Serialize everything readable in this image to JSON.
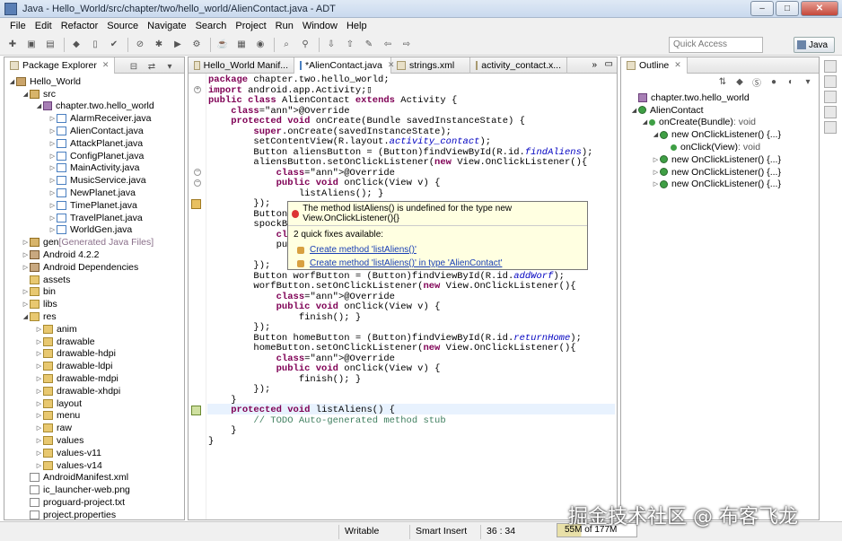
{
  "window": {
    "title": "Java - Hello_World/src/chapter/two/hello_world/AlienContact.java - ADT"
  },
  "menu": [
    "File",
    "Edit",
    "Refactor",
    "Source",
    "Navigate",
    "Search",
    "Project",
    "Run",
    "Window",
    "Help"
  ],
  "toolbar": {
    "quick_access_placeholder": "Quick Access",
    "perspective_label": "Java"
  },
  "package_explorer": {
    "tab_label": "Package Explorer",
    "tree": [
      {
        "label": "Hello_World",
        "icon": "project",
        "twisty": "open",
        "indent": 0
      },
      {
        "label": "src",
        "icon": "src",
        "twisty": "open",
        "indent": 1
      },
      {
        "label": "chapter.two.hello_world",
        "icon": "pkg",
        "twisty": "open",
        "indent": 2
      },
      {
        "label": "AlarmReceiver.java",
        "icon": "java",
        "twisty": "closed",
        "indent": 3
      },
      {
        "label": "AlienContact.java",
        "icon": "java",
        "twisty": "closed",
        "indent": 3
      },
      {
        "label": "AttackPlanet.java",
        "icon": "java",
        "twisty": "closed",
        "indent": 3
      },
      {
        "label": "ConfigPlanet.java",
        "icon": "java",
        "twisty": "closed",
        "indent": 3
      },
      {
        "label": "MainActivity.java",
        "icon": "java",
        "twisty": "closed",
        "indent": 3
      },
      {
        "label": "MusicService.java",
        "icon": "java",
        "twisty": "closed",
        "indent": 3
      },
      {
        "label": "NewPlanet.java",
        "icon": "java",
        "twisty": "closed",
        "indent": 3
      },
      {
        "label": "TimePlanet.java",
        "icon": "java",
        "twisty": "closed",
        "indent": 3
      },
      {
        "label": "TravelPlanet.java",
        "icon": "java",
        "twisty": "closed",
        "indent": 3
      },
      {
        "label": "WorldGen.java",
        "icon": "java",
        "twisty": "closed",
        "indent": 3
      },
      {
        "label": "gen",
        "suffix": "[Generated Java Files]",
        "icon": "src",
        "twisty": "closed",
        "indent": 1
      },
      {
        "label": "Android 4.2.2",
        "icon": "lib",
        "twisty": "closed",
        "indent": 1
      },
      {
        "label": "Android Dependencies",
        "icon": "lib",
        "twisty": "closed",
        "indent": 1
      },
      {
        "label": "assets",
        "icon": "folder",
        "twisty": "none",
        "indent": 1
      },
      {
        "label": "bin",
        "icon": "folder",
        "twisty": "closed",
        "indent": 1
      },
      {
        "label": "libs",
        "icon": "folder",
        "twisty": "closed",
        "indent": 1
      },
      {
        "label": "res",
        "icon": "folder",
        "twisty": "open",
        "indent": 1
      },
      {
        "label": "anim",
        "icon": "folder",
        "twisty": "closed",
        "indent": 2
      },
      {
        "label": "drawable",
        "icon": "folder",
        "twisty": "closed",
        "indent": 2
      },
      {
        "label": "drawable-hdpi",
        "icon": "folder",
        "twisty": "closed",
        "indent": 2
      },
      {
        "label": "drawable-ldpi",
        "icon": "folder",
        "twisty": "closed",
        "indent": 2
      },
      {
        "label": "drawable-mdpi",
        "icon": "folder",
        "twisty": "closed",
        "indent": 2
      },
      {
        "label": "drawable-xhdpi",
        "icon": "folder",
        "twisty": "closed",
        "indent": 2
      },
      {
        "label": "layout",
        "icon": "folder",
        "twisty": "closed",
        "indent": 2
      },
      {
        "label": "menu",
        "icon": "folder",
        "twisty": "closed",
        "indent": 2
      },
      {
        "label": "raw",
        "icon": "folder",
        "twisty": "closed",
        "indent": 2
      },
      {
        "label": "values",
        "icon": "folder",
        "twisty": "closed",
        "indent": 2
      },
      {
        "label": "values-v11",
        "icon": "folder",
        "twisty": "closed",
        "indent": 2
      },
      {
        "label": "values-v14",
        "icon": "folder",
        "twisty": "closed",
        "indent": 2
      },
      {
        "label": "AndroidManifest.xml",
        "icon": "file",
        "twisty": "none",
        "indent": 1
      },
      {
        "label": "ic_launcher-web.png",
        "icon": "file",
        "twisty": "none",
        "indent": 1
      },
      {
        "label": "proguard-project.txt",
        "icon": "file",
        "twisty": "none",
        "indent": 1
      },
      {
        "label": "project.properties",
        "icon": "file",
        "twisty": "none",
        "indent": 1
      }
    ]
  },
  "editor": {
    "tabs": [
      "Hello_World Manif...",
      "*AlienContact.java",
      "strings.xml",
      "activity_contact.x..."
    ],
    "active_tab": 1,
    "lines": [
      "package chapter.two.hello_world;",
      "import android.app.Activity;▯",
      "public class AlienContact extends Activity {",
      "    @Override",
      "    protected void onCreate(Bundle savedInstanceState) {",
      "        super.onCreate(savedInstanceState);",
      "        setContentView(R.layout.activity_contact);",
      "        Button aliensButton = (Button)findViewById(R.id.findAliens);",
      "        aliensButton.setOnClickListener(new View.OnClickListener(){",
      "            @Override",
      "            public void onClick(View v) {",
      "                listAliens(); }",
      "        });",
      "        Button s",
      "        spockBut",
      "            @Ove",
      "            publ",
      "",
      "        });",
      "        Button worfButton = (Button)findViewById(R.id.addWorf);",
      "        worfButton.setOnClickListener(new View.OnClickListener(){",
      "            @Override",
      "            public void onClick(View v) {",
      "                finish(); }",
      "        });",
      "        Button homeButton = (Button)findViewById(R.id.returnHome);",
      "        homeButton.setOnClickListener(new View.OnClickListener(){",
      "            @Override",
      "            public void onClick(View v) {",
      "                finish(); }",
      "        });",
      "    }",
      "    protected void listAliens() {",
      "        // TODO Auto-generated method stub",
      "    }",
      "}"
    ]
  },
  "quickfix": {
    "title": "The method listAliens() is undefined for the type new View.OnClickListener(){}",
    "count": "2 quick fixes available:",
    "items": [
      "Create method 'listAliens()'",
      "Create method 'listAliens()' in type 'AlienContact'"
    ]
  },
  "outline": {
    "tab_label": "Outline",
    "tree": [
      {
        "label": "chapter.two.hello_world",
        "icon": "pkg",
        "indent": 0,
        "twisty": "none"
      },
      {
        "label": "AlienContact",
        "icon": "cls",
        "indent": 0,
        "twisty": "open"
      },
      {
        "label": "onCreate(Bundle)",
        "suffix": ": void",
        "icon": "method",
        "indent": 1,
        "twisty": "open"
      },
      {
        "label": "new OnClickListener() {...}",
        "icon": "cls",
        "indent": 2,
        "twisty": "open"
      },
      {
        "label": "onClick(View)",
        "suffix": ": void",
        "icon": "method",
        "indent": 3,
        "twisty": "none"
      },
      {
        "label": "new OnClickListener() {...}",
        "icon": "cls",
        "indent": 2,
        "twisty": "closed"
      },
      {
        "label": "new OnClickListener() {...}",
        "icon": "cls",
        "indent": 2,
        "twisty": "closed"
      },
      {
        "label": "new OnClickListener() {...}",
        "icon": "cls",
        "indent": 2,
        "twisty": "closed"
      }
    ]
  },
  "status": {
    "writable": "Writable",
    "insert_mode": "Smart Insert",
    "position": "36 : 34",
    "heap": "55M of 177M"
  },
  "watermark": "掘金技术社区 @ 布客飞龙"
}
